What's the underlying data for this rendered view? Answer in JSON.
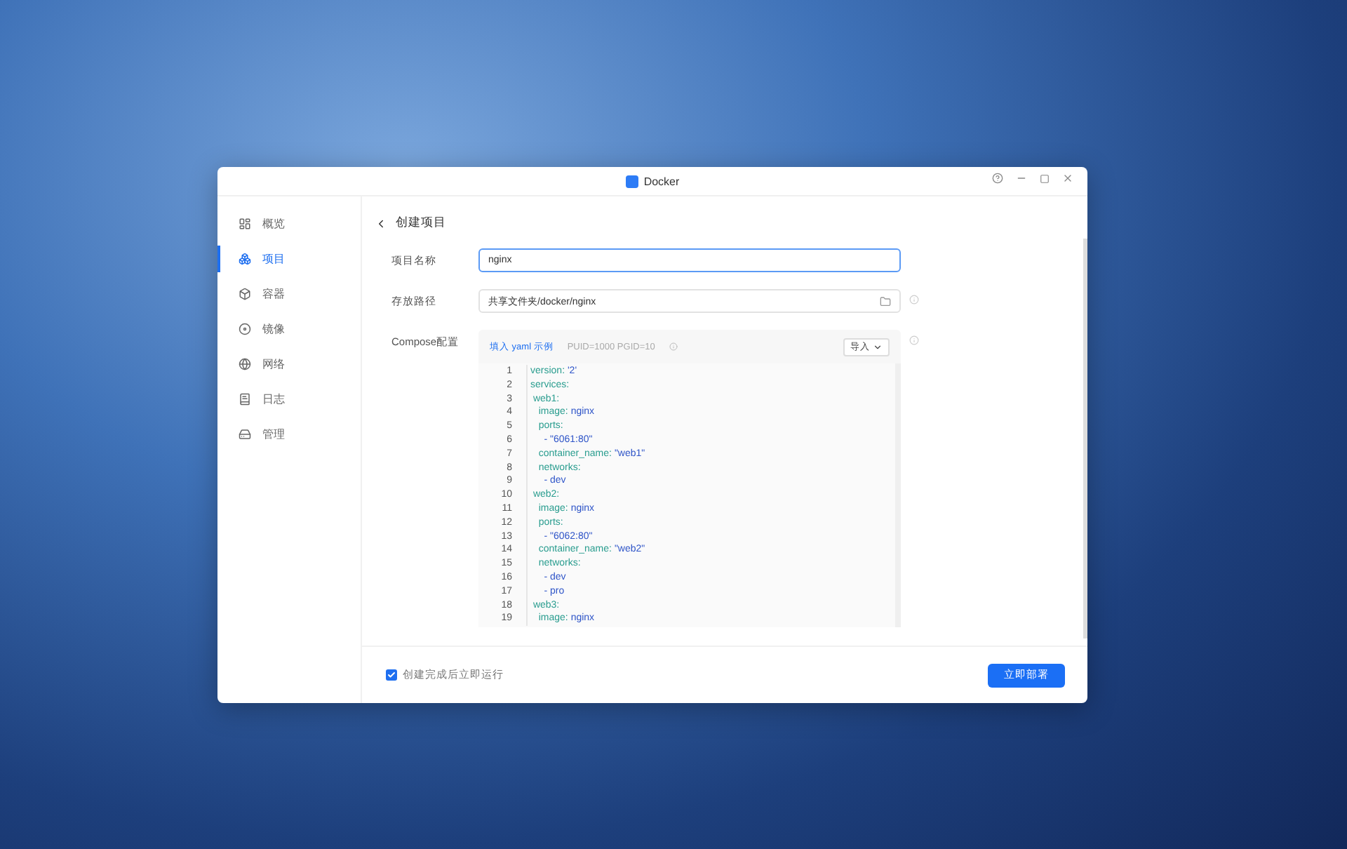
{
  "window": {
    "title": "Docker"
  },
  "sidebar": {
    "items": [
      {
        "label": "概览",
        "selected": false,
        "kind": "overview"
      },
      {
        "label": "项目",
        "selected": true,
        "kind": "project"
      },
      {
        "label": "容器",
        "selected": false,
        "kind": "container"
      },
      {
        "label": "镜像",
        "selected": false,
        "kind": "image"
      },
      {
        "label": "网络",
        "selected": false,
        "kind": "network"
      },
      {
        "label": "日志",
        "selected": false,
        "kind": "log"
      },
      {
        "label": "管理",
        "selected": false,
        "kind": "manage"
      }
    ]
  },
  "page": {
    "title": "创建项目"
  },
  "form": {
    "name": {
      "label": "项目名称",
      "value": "nginx"
    },
    "path": {
      "label": "存放路径",
      "value": "共享文件夹/docker/nginx"
    },
    "compose": {
      "label": "Compose配置",
      "example_link": "填入 yaml 示例",
      "env_hint": "PUID=1000 PGID=10",
      "import_button": "导入",
      "lines": [
        {
          "number": "1",
          "key": "version:",
          "value": "'2'"
        },
        {
          "number": "2",
          "key": "services:"
        },
        {
          "number": "3",
          "key": " web1:"
        },
        {
          "number": "4",
          "key": "   image:",
          "value": "nginx"
        },
        {
          "number": "5",
          "key": "   ports:"
        },
        {
          "number": "6",
          "value": "     - \"6061:80\""
        },
        {
          "number": "7",
          "key": "   container_name:",
          "value": "\"web1\""
        },
        {
          "number": "8",
          "key": "   networks:"
        },
        {
          "number": "9",
          "value": "     - dev"
        },
        {
          "number": "10",
          "key": " web2:"
        },
        {
          "number": "11",
          "key": "   image:",
          "value": "nginx"
        },
        {
          "number": "12",
          "key": "   ports:"
        },
        {
          "number": "13",
          "value": "     - \"6062:80\""
        },
        {
          "number": "14",
          "key": "   container_name:",
          "value": "\"web2\""
        },
        {
          "number": "15",
          "key": "   networks:"
        },
        {
          "number": "16",
          "value": "     - dev"
        },
        {
          "number": "17",
          "value": "     - pro"
        },
        {
          "number": "18",
          "key": " web3:"
        },
        {
          "number": "19",
          "key": "   image:",
          "value": "nginx"
        }
      ]
    }
  },
  "footer": {
    "run_after_create": {
      "label": "创建完成后立即运行",
      "checked": true
    },
    "deploy_button": "立即部署"
  }
}
